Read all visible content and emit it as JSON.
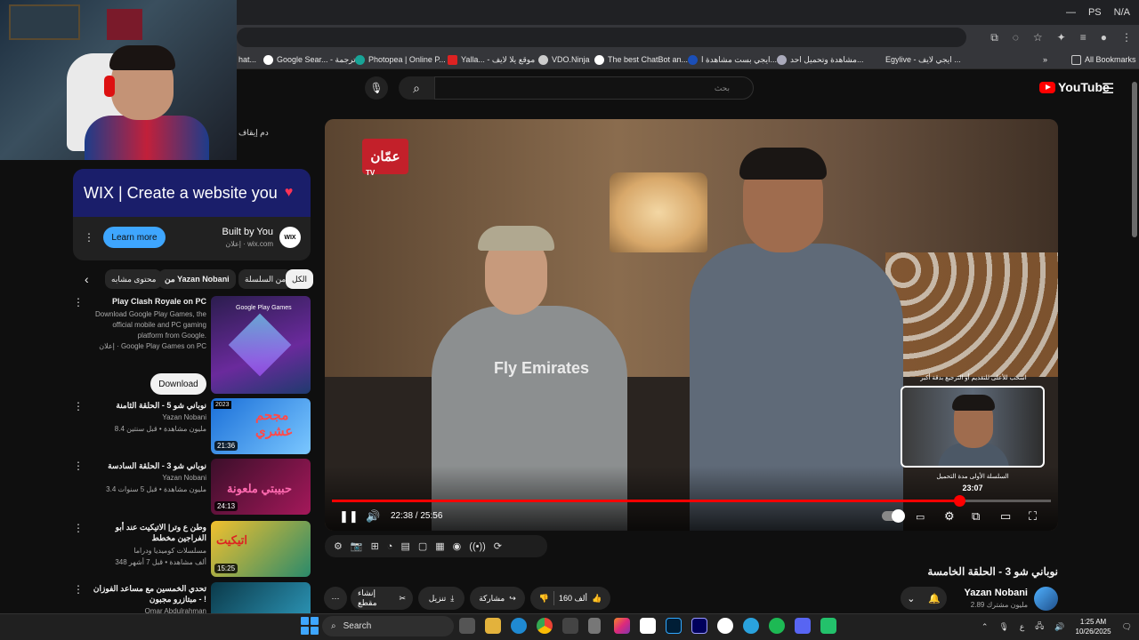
{
  "window": {
    "controls": [
      "—",
      "PS",
      "N/A"
    ]
  },
  "bookmarks": [
    {
      "label": "hat..."
    },
    {
      "label": "Google Sear... - ترجمة"
    },
    {
      "label": "Photopea | Online P..."
    },
    {
      "label": "Yalla... - موقع يلا لايف"
    },
    {
      "label": "VDO.Ninja"
    },
    {
      "label": "The best ChatBot an..."
    },
    {
      "label": "ايجي بست مشاهدة ا..."
    },
    {
      "label": "مشاهدة وتحميل احد..."
    },
    {
      "label": "Egylive - ايجي لايف ..."
    },
    {
      "label": "All Bookmarks"
    }
  ],
  "webcam": {
    "stop_label": "دم إيقاف"
  },
  "youtube": {
    "logo_text": "YouTube",
    "search_placeholder": "بحث",
    "search_value": ""
  },
  "ad": {
    "banner_text": "WIX | Create a website you",
    "title": "Built by You",
    "subtitle": "إعلان · wix.com",
    "logo": "WIX",
    "cta": "Learn more"
  },
  "chips": [
    "الكل",
    "من السلسلة",
    "من Yazan Nobani",
    "محتوى مشابه"
  ],
  "sidebar": {
    "promo": {
      "title": "Play Clash Royale on PC",
      "desc": "Download Google Play Games, the official mobile and PC gaming platform from Google.",
      "meta": "إعلان · Google Play Games on PC",
      "cta": "Download",
      "thumb_label": "Google Play Games"
    },
    "items": [
      {
        "title": "نوباني شو 5 - الحلقة الثامنة",
        "channel": "Yazan Nobani",
        "meta": "8.4 مليون مشاهدة • قبل سنتين",
        "duration": "21:36",
        "thumb_text": "مجحم عشري",
        "year": "2023"
      },
      {
        "title": "نوباني شو 3 - الحلقة السادسة",
        "channel": "Yazan Nobani",
        "meta": "3.4 مليون مشاهدة • قبل 5 سنوات",
        "duration": "24:13",
        "thumb_text": "حبيبتي ملعونة"
      },
      {
        "title": "وطن ع وتر| الاتيكيت عند أبو الفراجين مخطط",
        "channel": "مسلسلات كوميديا ودراما",
        "meta": "348 ألف مشاهدة • قبل 7 أشهر",
        "duration": "15:25",
        "thumb_text": "اتيكيت"
      },
      {
        "title": "تحدي الخمسين مع مساعد الفوزان - مبتازرو مجبون !",
        "channel": "Omar Abdulrahman",
        "meta": "",
        "duration": ""
      }
    ]
  },
  "player": {
    "channel_logo": "عمّان",
    "channel_logo_sub": "TV",
    "current_time": "22:38",
    "duration": "25:56",
    "time_display": "22:38 / 25:56",
    "progress": 0.873,
    "preview_hint": "اسحب للأعلى للتقديم أو الترجيع بدقة أكبر",
    "preview_chapter": "السلسلة الأولى مدة التحميل",
    "preview_time": "23:07",
    "shirt_text": "Fly Emirates"
  },
  "ext_bar": {
    "icons": [
      "gear-icon",
      "camera-icon",
      "plus-box-icon",
      "speedometer-icon",
      "film-icon",
      "frame-icon",
      "clapperboard-icon",
      "eye-box-icon",
      "broadcast-icon",
      "loop-icon"
    ]
  },
  "video": {
    "title": "نوباني شو 3 - الحلقة الخامسة",
    "channel": "Yazan Nobani",
    "subs": "2.89 مليون مشترك",
    "likes": "160 ألف",
    "share": "مشاركة",
    "download": "تنزيل",
    "clip": "إنشاء مقطع"
  },
  "taskbar": {
    "search": "Search",
    "time": "1:25 AM",
    "date": "10/26/2025",
    "lang": "ع"
  },
  "colors": {
    "accent": "#3ea6ff",
    "progress": "#ff0000",
    "brand": "#ff0000"
  }
}
